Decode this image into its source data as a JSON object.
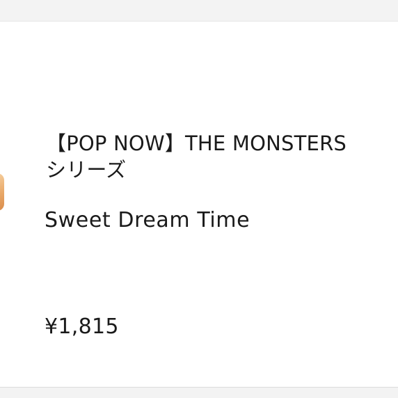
{
  "product": {
    "title_line1": "【POP NOW】THE MONSTERS",
    "title_line2": "シリーズ",
    "variant": "Sweet Dream Time",
    "price": "¥1,815",
    "thumbnail_icon": "product-thumbnail-image"
  },
  "colors": {
    "text": "#1a1a1a",
    "background": "#ffffff",
    "divider": "#f3f3f3",
    "thumbnail_accent": "#e9a969"
  }
}
